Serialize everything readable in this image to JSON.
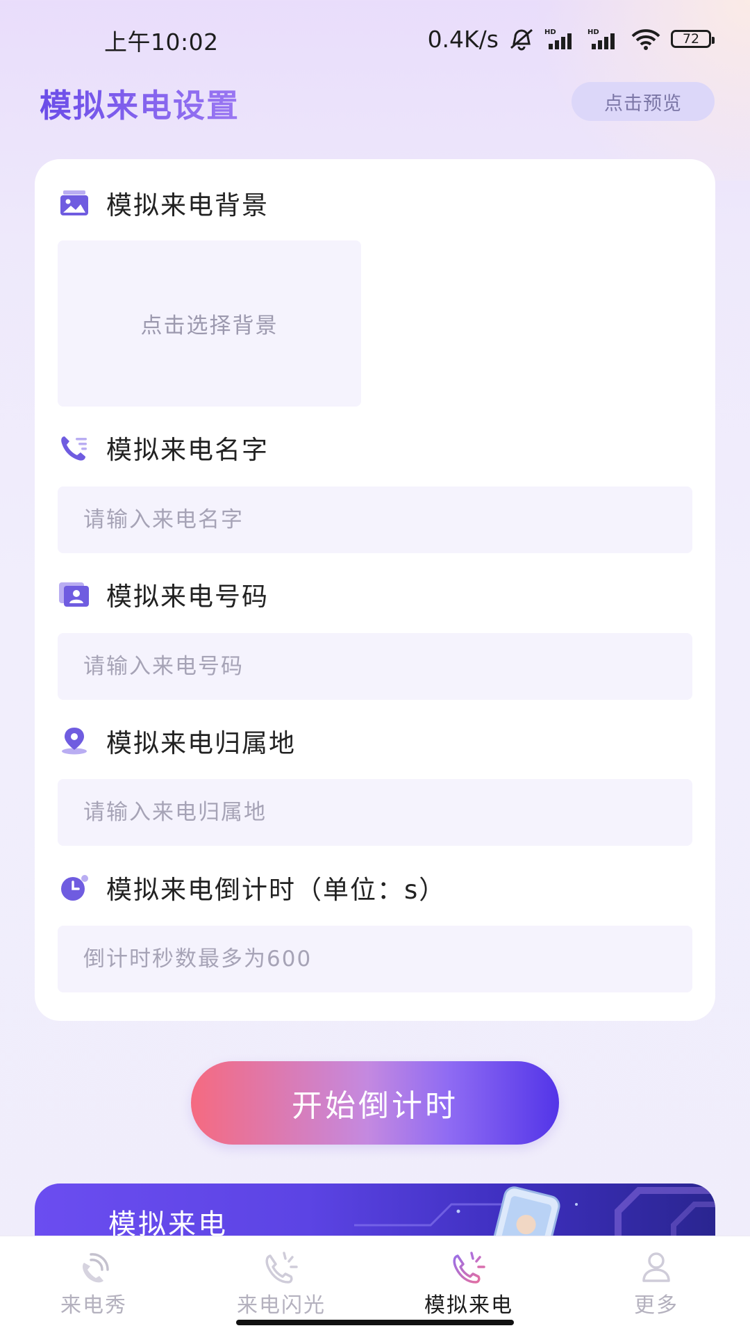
{
  "status_bar": {
    "time": "上午10:02",
    "net_speed": "0.4K/s",
    "battery": "72"
  },
  "header": {
    "title": "模拟来电设置",
    "preview_label": "点击预览"
  },
  "form": {
    "background": {
      "label": "模拟来电背景",
      "picker_text": "点击选择背景"
    },
    "name": {
      "label": "模拟来电名字",
      "placeholder": "请输入来电名字",
      "value": ""
    },
    "number": {
      "label": "模拟来电号码",
      "placeholder": "请输入来电号码",
      "value": ""
    },
    "location": {
      "label": "模拟来电归属地",
      "placeholder": "请输入来电归属地",
      "value": ""
    },
    "countdown": {
      "label": "模拟来电倒计时（单位：s）",
      "placeholder": "倒计时秒数最多为600",
      "value": ""
    }
  },
  "start_button": "开始倒计时",
  "banner": {
    "title": "模拟来电"
  },
  "bottom_nav": {
    "items": [
      {
        "label": "来电秀",
        "icon": "call-show-icon",
        "active": false
      },
      {
        "label": "来电闪光",
        "icon": "call-flash-icon",
        "active": false
      },
      {
        "label": "模拟来电",
        "icon": "fake-call-icon",
        "active": true
      },
      {
        "label": "更多",
        "icon": "user-icon",
        "active": false
      }
    ]
  },
  "colors": {
    "accent": "#6A4CE8",
    "icon_purple": "#6F5CE0",
    "inactive_nav": "#B4B1BE",
    "field_bg": "#F5F3FD"
  }
}
